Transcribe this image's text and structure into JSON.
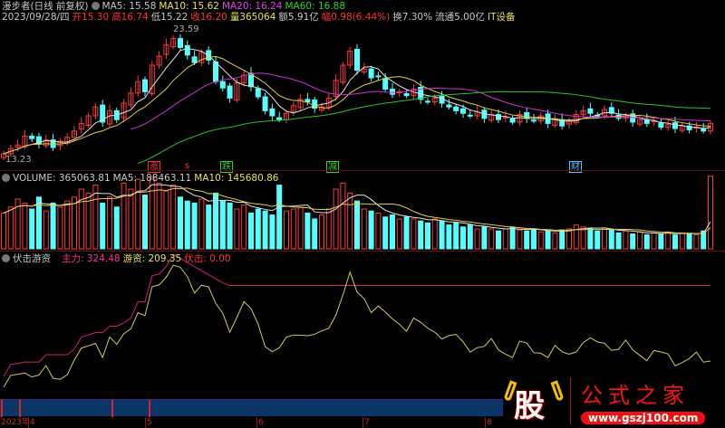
{
  "header": {
    "title": "漫步者(日线 前复权)",
    "ma5": "MA5: 15.58",
    "ma10": "MA10: 15.62",
    "ma20": "MA20: 16.24",
    "ma60": "MA60: 16.88",
    "date": "2023/09/28/四",
    "open": "开15.30",
    "high": "高16.74",
    "low": "低15.22",
    "close": "收16.20",
    "vol": "量365064",
    "amount": "额5.91亿",
    "change": "幅0.98(6.44%)",
    "turnover": "换7.30%",
    "float": "流通5.00亿",
    "sector": "IT设备"
  },
  "price_chart": {
    "max_label": "23.59",
    "min_label": "13.23",
    "signals": [
      {
        "text": "涨",
        "color": "#ff3030"
      },
      {
        "text": "s",
        "color": "#ff3030"
      },
      {
        "text": "跌",
        "color": "#30d030"
      },
      {
        "text": "减",
        "color": "#30d030"
      },
      {
        "text": "财",
        "color": "#60c0ff"
      }
    ],
    "closes": [
      13.8,
      14.2,
      14.5,
      15.2,
      15.0,
      14.6,
      14.9,
      14.3,
      14.8,
      15.1,
      15.6,
      16.2,
      16.8,
      17.5,
      16.3,
      17.2,
      16.5,
      17.8,
      18.6,
      19.5,
      18.7,
      20.8,
      21.5,
      22.4,
      22.9,
      22.2,
      21.6,
      21.0,
      21.8,
      21.2,
      19.5,
      19.0,
      18.2,
      19.4,
      20.0,
      19.1,
      18.3,
      17.2,
      16.8,
      16.5,
      17.0,
      17.6,
      18.1,
      17.9,
      17.4,
      17.5,
      18.2,
      19.6,
      20.8,
      21.9,
      20.4,
      20.5,
      19.8,
      19.9,
      18.9,
      18.5,
      18.7,
      18.4,
      18.9,
      18.1,
      17.9,
      18.2,
      17.8,
      17.5,
      17.2,
      17.0,
      16.8,
      17.1,
      16.6,
      16.9,
      16.5,
      16.7,
      16.3,
      16.9,
      16.6,
      16.4,
      16.8,
      16.2,
      16.5,
      16.0,
      16.4,
      16.9,
      17.2,
      17.0,
      16.8,
      17.3,
      17.0,
      16.6,
      16.8,
      16.3,
      16.5,
      16.2,
      16.4,
      15.9,
      16.1,
      15.8,
      16.0,
      15.7,
      15.9,
      15.6,
      16.2
    ]
  },
  "volume": {
    "label": "VOLUME: 365063.81",
    "ma5": "MA5: 188463.11",
    "ma10": "MA10: 145680.86",
    "values": [
      180,
      210,
      250,
      230,
      200,
      260,
      190,
      230,
      210,
      240,
      260,
      300,
      280,
      320,
      230,
      260,
      210,
      330,
      300,
      350,
      270,
      360,
      330,
      290,
      320,
      260,
      240,
      230,
      250,
      220,
      280,
      240,
      230,
      200,
      220,
      180,
      200,
      190,
      170,
      320,
      190,
      200,
      210,
      180,
      150,
      170,
      200,
      300,
      330,
      280,
      240,
      200,
      190,
      180,
      160,
      170,
      150,
      160,
      150,
      140,
      130,
      150,
      140,
      120,
      130,
      110,
      120,
      100,
      110,
      100,
      90,
      100,
      110,
      95,
      90,
      100,
      85,
      90,
      80,
      95,
      100,
      120,
      110,
      100,
      90,
      105,
      95,
      80,
      90,
      75,
      85,
      70,
      80,
      75,
      85,
      70,
      80,
      75,
      70,
      90,
      365
    ]
  },
  "indicator": {
    "title": "伏击游资",
    "zhuli": "主力: 324.48",
    "youzi": "游资: 209.35",
    "fuji": "伏击: 0.00"
  },
  "axis": {
    "labels": [
      "2023年",
      "4",
      "5",
      "6",
      "7",
      "8"
    ]
  },
  "logo": {
    "char": "股",
    "name": "公式之家",
    "url": "www.gszj100.com"
  }
}
